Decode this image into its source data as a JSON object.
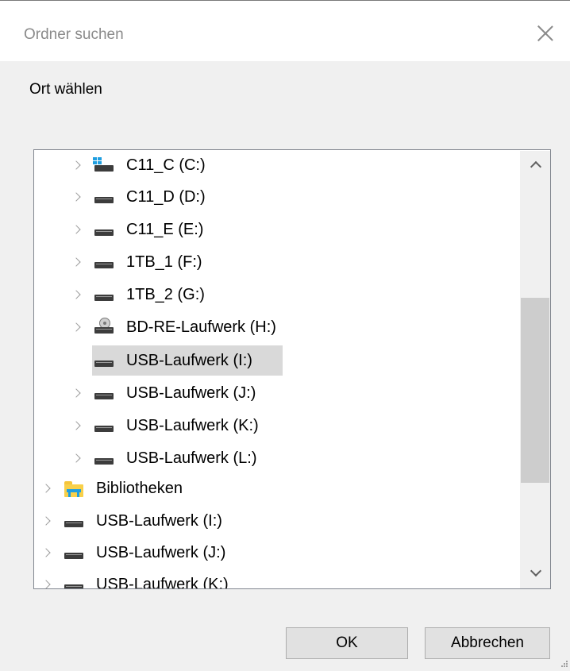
{
  "window": {
    "title": "Ordner suchen",
    "close_icon": "close-icon"
  },
  "dialog": {
    "prompt": "Ort wählen"
  },
  "tree": {
    "items": [
      {
        "label": "C11_C (C:)",
        "icon": "windows-drive-icon",
        "expandable": true,
        "level": 1
      },
      {
        "label": "C11_D (D:)",
        "icon": "drive-icon",
        "expandable": true,
        "level": 1
      },
      {
        "label": "C11_E (E:)",
        "icon": "drive-icon",
        "expandable": true,
        "level": 1
      },
      {
        "label": "1TB_1 (F:)",
        "icon": "drive-icon",
        "expandable": true,
        "level": 1
      },
      {
        "label": "1TB_2 (G:)",
        "icon": "drive-icon",
        "expandable": true,
        "level": 1
      },
      {
        "label": "BD-RE-Laufwerk (H:)",
        "icon": "optical-drive-icon",
        "expandable": true,
        "level": 1
      },
      {
        "label": "USB-Laufwerk (I:)",
        "icon": "drive-icon",
        "expandable": false,
        "level": 1,
        "selected": true
      },
      {
        "label": "USB-Laufwerk (J:)",
        "icon": "drive-icon",
        "expandable": true,
        "level": 1
      },
      {
        "label": "USB-Laufwerk (K:)",
        "icon": "drive-icon",
        "expandable": true,
        "level": 1
      },
      {
        "label": "USB-Laufwerk (L:)",
        "icon": "drive-icon",
        "expandable": true,
        "level": 1
      },
      {
        "label": "Bibliotheken",
        "icon": "libraries-icon",
        "expandable": true,
        "level": 0
      },
      {
        "label": "USB-Laufwerk (I:)",
        "icon": "drive-icon",
        "expandable": true,
        "level": 0
      },
      {
        "label": "USB-Laufwerk (J:)",
        "icon": "drive-icon",
        "expandable": true,
        "level": 0
      },
      {
        "label": "USB-Laufwerk (K:)",
        "icon": "drive-icon",
        "expandable": true,
        "level": 0
      }
    ]
  },
  "buttons": {
    "ok_label": "OK",
    "cancel_label": "Abbrechen"
  },
  "colors": {
    "selection": "#d9d9d9",
    "dialog_background": "#f0f0f0",
    "accent": "#1e9ee0"
  }
}
